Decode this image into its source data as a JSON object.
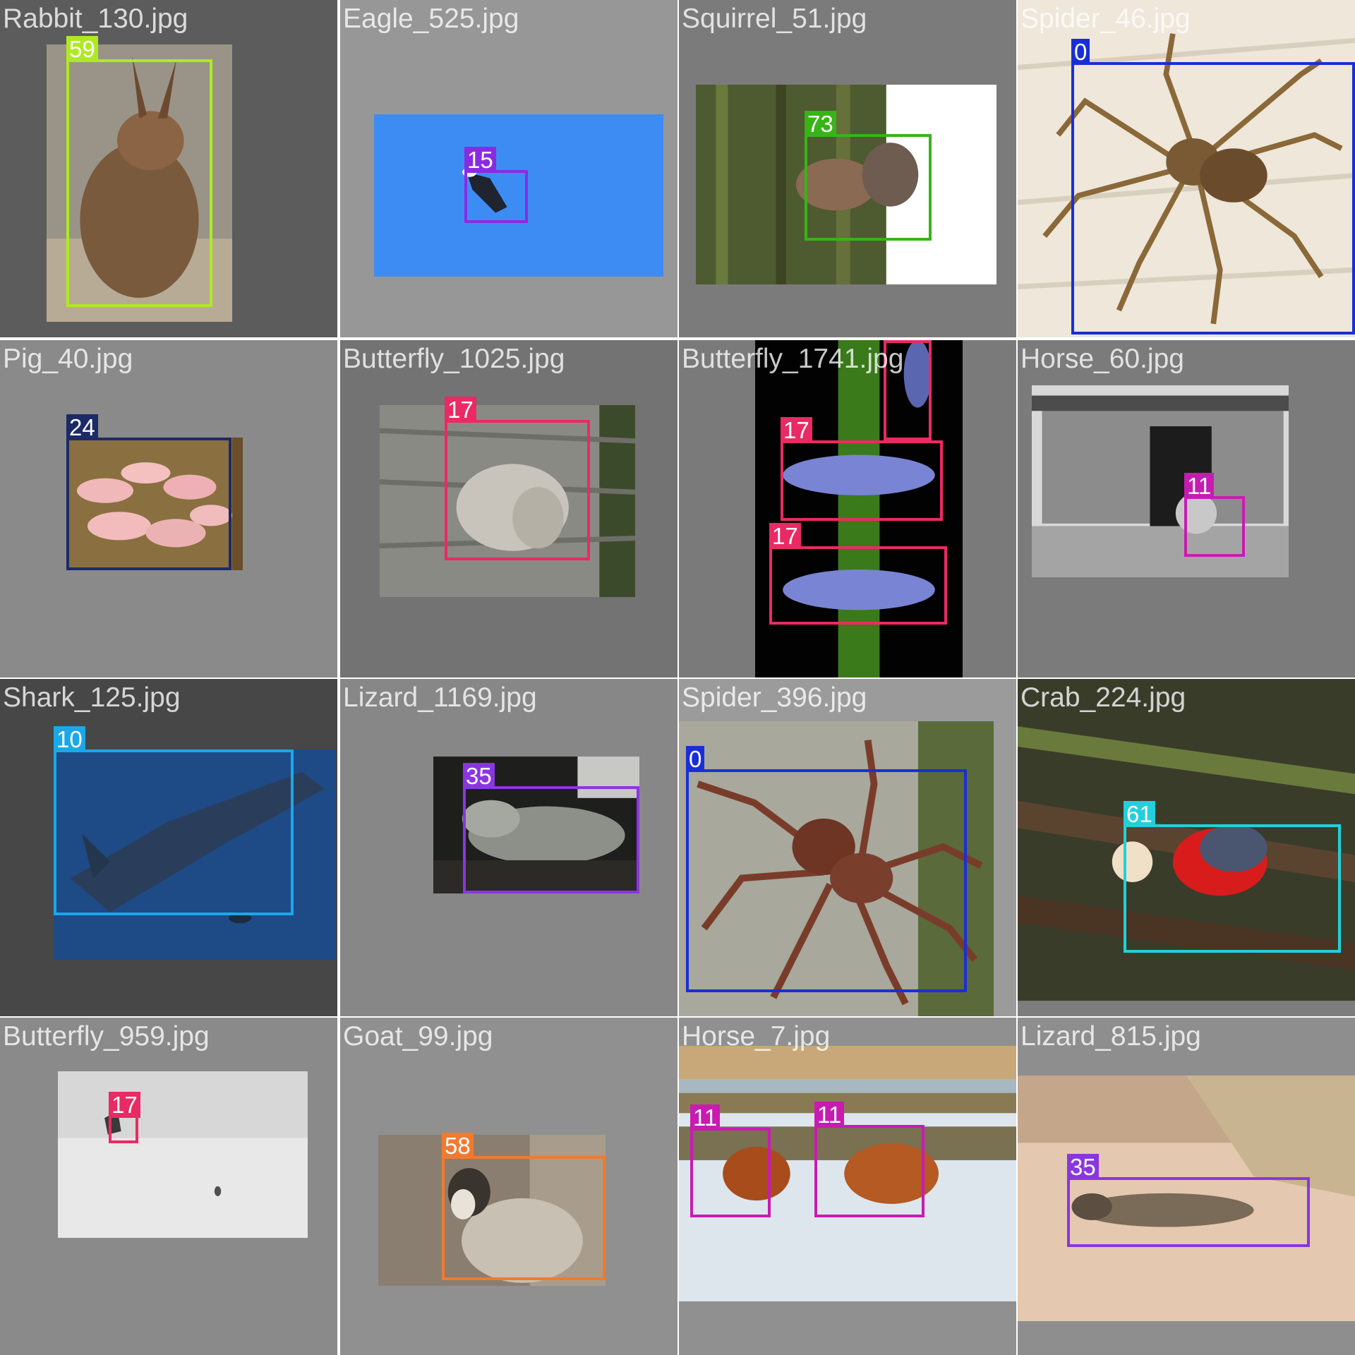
{
  "tiles": [
    {
      "file": "Rabbit_130.jpg",
      "labels": [
        "59"
      ],
      "bg": "#5c5c5c"
    },
    {
      "file": "Eagle_525.jpg",
      "labels": [
        "15"
      ],
      "bg": "#979797"
    },
    {
      "file": "Squirrel_51.jpg",
      "labels": [
        "73"
      ],
      "bg": "#7b7b7b"
    },
    {
      "file": "Spider_46.jpg",
      "labels": [
        "0"
      ],
      "bg": "#e8e0d2"
    },
    {
      "file": "Pig_40.jpg",
      "labels": [
        "24"
      ],
      "bg": "#8a8a8a"
    },
    {
      "file": "Butterfly_1025.jpg",
      "labels": [
        "17"
      ],
      "bg": "#737373"
    },
    {
      "file": "Butterfly_1741.jpg",
      "labels": [
        "17",
        "17",
        "17"
      ],
      "bg": "#7a7a7a"
    },
    {
      "file": "Horse_60.jpg",
      "labels": [
        "11"
      ],
      "bg": "#7b7b7b"
    },
    {
      "file": "Shark_125.jpg",
      "labels": [
        "10"
      ],
      "bg": "#474747"
    },
    {
      "file": "Lizard_1169.jpg",
      "labels": [
        "35"
      ],
      "bg": "#878787"
    },
    {
      "file": "Spider_396.jpg",
      "labels": [
        "0"
      ],
      "bg": "#9b9b9b"
    },
    {
      "file": "Crab_224.jpg",
      "labels": [
        "61"
      ],
      "bg": "#7d7d7d"
    },
    {
      "file": "Butterfly_959.jpg",
      "labels": [
        "17"
      ],
      "bg": "#8a8a8a"
    },
    {
      "file": "Goat_99.jpg",
      "labels": [
        "58"
      ],
      "bg": "#909090"
    },
    {
      "file": "Horse_7.jpg",
      "labels": [
        "11",
        "11"
      ],
      "bg": "#909090"
    },
    {
      "file": "Lizard_815.jpg",
      "labels": [
        "35"
      ],
      "bg": "#8e8e8e"
    }
  ],
  "class_colors": {
    "0": "#1a2ed8",
    "10": "#1aa8e8",
    "11": "#c81cb0",
    "15": "#8a2be2",
    "17": "#ea2a64",
    "24": "#1c2a68",
    "35": "#8a36e0",
    "58": "#f07a30",
    "59": "#aeea22",
    "61": "#22d0dc",
    "73": "#38b418"
  }
}
